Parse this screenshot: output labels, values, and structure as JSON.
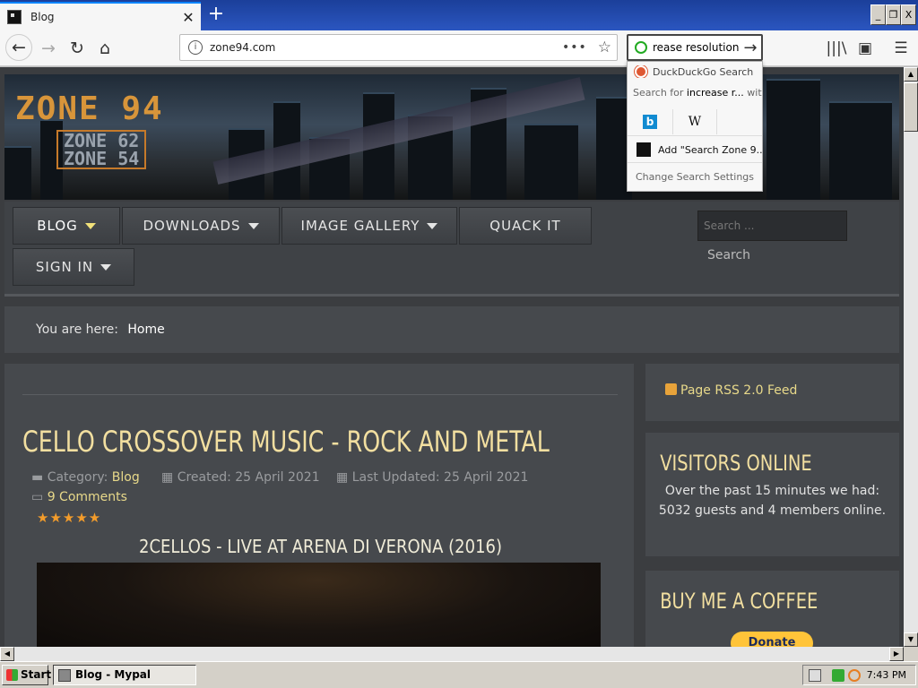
{
  "browser": {
    "tab_title": "Blog",
    "url": "zone94.com",
    "search_query": "rease resolution",
    "window_controls": [
      "_",
      "❐",
      "X"
    ]
  },
  "search_dropdown": {
    "engine_label": "DuckDuckGo Search",
    "search_for_prefix": "Search for",
    "search_for_term": "increase r...",
    "search_for_suffix": "with:",
    "engine_bing_label": "b",
    "engine_wikipedia_label": "W",
    "add_engine": "Add \"Search Zone 9...",
    "change_settings": "Change Search Settings"
  },
  "site": {
    "logo_main": "ZONE 94",
    "logo_sub1": "ZONE 62",
    "logo_sub2": "ZONE 54",
    "nav": {
      "blog": "BLOG",
      "downloads": "DOWNLOADS",
      "image_gallery": "IMAGE GALLERY",
      "quack_it": "QUACK IT",
      "sign_in": "SIGN IN"
    },
    "search_placeholder": "Search ...",
    "search_button": "Search",
    "breadcrumb_prefix": "You are here:",
    "breadcrumb_home": "Home"
  },
  "article": {
    "title": "CELLO CROSSOVER MUSIC - ROCK AND METAL",
    "category_label": "Category:",
    "category": "Blog",
    "created": "Created: 25 April 2021",
    "updated": "Last Updated: 25 April 2021",
    "comments": "9 Comments",
    "rating_stars": "★★★★★",
    "video_title": "2CELLOS - LIVE AT ARENA DI VERONA (2016)"
  },
  "sidebar": {
    "rss": "Page RSS 2.0 Feed",
    "visitors_title": "VISITORS ONLINE",
    "visitors_text": "Over the past 15 minutes we had: 5032 guests and 4 members online.",
    "coffee_title": "BUY ME A COFFEE",
    "donate": "Donate"
  },
  "taskbar": {
    "start": "Start",
    "task": "Blog - Mypal",
    "clock": "7:43 PM"
  }
}
